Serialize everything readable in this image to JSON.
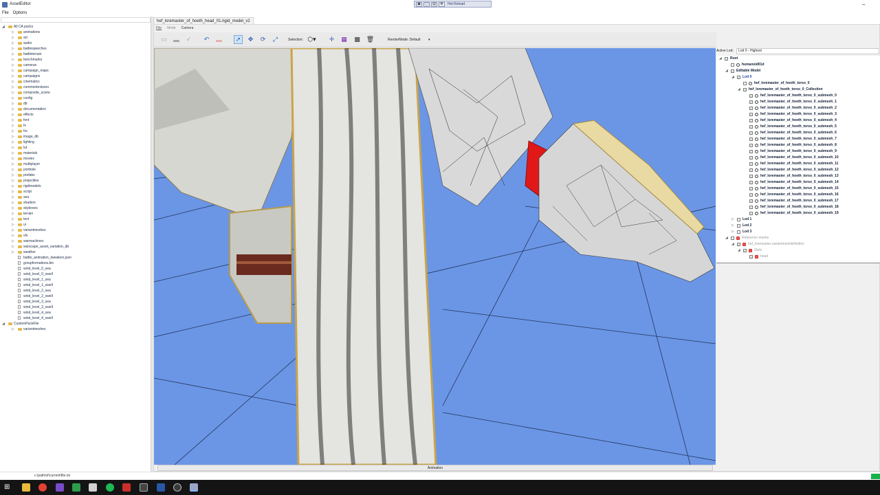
{
  "window": {
    "title": "AssetEditor"
  },
  "hot_reload": {
    "label": "Hot Reload"
  },
  "menubar": {
    "file": "File",
    "options": "Options"
  },
  "pack_tree": [
    {
      "label": "All CA packs",
      "level": 0,
      "kind": "root",
      "expanded": true
    },
    {
      "label": "animations",
      "level": 1,
      "kind": "folder"
    },
    {
      "label": "art",
      "level": 1,
      "kind": "folder"
    },
    {
      "label": "audio",
      "level": 1,
      "kind": "folder"
    },
    {
      "label": "battlespeeches",
      "level": 1,
      "kind": "folder"
    },
    {
      "label": "battleterrain",
      "level": 1,
      "kind": "folder"
    },
    {
      "label": "benchmarks",
      "level": 1,
      "kind": "folder"
    },
    {
      "label": "cameras",
      "level": 1,
      "kind": "folder"
    },
    {
      "label": "campaign_maps",
      "level": 1,
      "kind": "folder"
    },
    {
      "label": "campaigns",
      "level": 1,
      "kind": "folder"
    },
    {
      "label": "cinematics",
      "level": 1,
      "kind": "folder"
    },
    {
      "label": "commontextures",
      "level": 1,
      "kind": "folder"
    },
    {
      "label": "composite_scene",
      "level": 1,
      "kind": "folder"
    },
    {
      "label": "config",
      "level": 1,
      "kind": "folder"
    },
    {
      "label": "db",
      "level": 1,
      "kind": "folder"
    },
    {
      "label": "documentation",
      "level": 1,
      "kind": "folder"
    },
    {
      "label": "effects",
      "level": 1,
      "kind": "folder"
    },
    {
      "label": "font",
      "level": 1,
      "kind": "folder"
    },
    {
      "label": "fx",
      "level": 1,
      "kind": "folder"
    },
    {
      "label": "fxc",
      "level": 1,
      "kind": "folder"
    },
    {
      "label": "image_db",
      "level": 1,
      "kind": "folder"
    },
    {
      "label": "lighting",
      "level": 1,
      "kind": "folder"
    },
    {
      "label": "lut",
      "level": 1,
      "kind": "folder"
    },
    {
      "label": "materials",
      "level": 1,
      "kind": "folder"
    },
    {
      "label": "movies",
      "level": 1,
      "kind": "folder"
    },
    {
      "label": "multiplayer",
      "level": 1,
      "kind": "folder"
    },
    {
      "label": "porthole",
      "level": 1,
      "kind": "folder"
    },
    {
      "label": "prefabs",
      "level": 1,
      "kind": "folder"
    },
    {
      "label": "projectiles",
      "level": 1,
      "kind": "folder"
    },
    {
      "label": "rigidmodels",
      "level": 1,
      "kind": "folder"
    },
    {
      "label": "script",
      "level": 1,
      "kind": "folder"
    },
    {
      "label": "sea",
      "level": 1,
      "kind": "folder"
    },
    {
      "label": "shaders",
      "level": 1,
      "kind": "folder"
    },
    {
      "label": "skyboxes",
      "level": 1,
      "kind": "folder"
    },
    {
      "label": "terrain",
      "level": 1,
      "kind": "folder"
    },
    {
      "label": "text",
      "level": 1,
      "kind": "folder"
    },
    {
      "label": "ui",
      "level": 1,
      "kind": "folder"
    },
    {
      "label": "variantmeshes",
      "level": 1,
      "kind": "folder"
    },
    {
      "label": "vfx",
      "level": 1,
      "kind": "folder"
    },
    {
      "label": "warmachines",
      "level": 1,
      "kind": "folder"
    },
    {
      "label": "warscape_asset_variation_db",
      "level": 1,
      "kind": "folder"
    },
    {
      "label": "weather",
      "level": 1,
      "kind": "folder"
    },
    {
      "label": "battle_animation_tweakers.json",
      "level": 1,
      "kind": "file"
    },
    {
      "label": "groupformations.bin",
      "level": 1,
      "kind": "file"
    },
    {
      "label": "wind_level_0_sea",
      "level": 1,
      "kind": "file"
    },
    {
      "label": "wind_level_0_swell",
      "level": 1,
      "kind": "file"
    },
    {
      "label": "wind_level_1_sea",
      "level": 1,
      "kind": "file"
    },
    {
      "label": "wind_level_1_swell",
      "level": 1,
      "kind": "file"
    },
    {
      "label": "wind_level_2_sea",
      "level": 1,
      "kind": "file"
    },
    {
      "label": "wind_level_2_swell",
      "level": 1,
      "kind": "file"
    },
    {
      "label": "wind_level_3_sea",
      "level": 1,
      "kind": "file"
    },
    {
      "label": "wind_level_3_swell",
      "level": 1,
      "kind": "file"
    },
    {
      "label": "wind_level_4_sea",
      "level": 1,
      "kind": "file"
    },
    {
      "label": "wind_level_4_swell",
      "level": 1,
      "kind": "file"
    },
    {
      "label": "CustomPackFile",
      "level": 0,
      "kind": "root",
      "expanded": true
    },
    {
      "label": "variantmeshes",
      "level": 1,
      "kind": "folder"
    }
  ],
  "editor": {
    "tab_title": "hef_loremaster_of_hoeth_head_01.rigid_model_v2",
    "menu": {
      "file": "File",
      "mode": "Mode",
      "camera": "Camera"
    },
    "toolbar": {
      "selection_label": "Selection:",
      "render_mode_label": "RenderMode: Default"
    },
    "animation_label": "Animation"
  },
  "right_panel": {
    "active_lod_label": "Active Lod:",
    "active_lod_value": "Lod 0 - Highest",
    "scene_tree": [
      {
        "label": "Root",
        "level": 0,
        "checked": true,
        "exp": "open",
        "icon": "none"
      },
      {
        "label": "humanoid01d",
        "level": 1,
        "checked": false,
        "exp": "",
        "icon": "skeleton"
      },
      {
        "label": "Editable Model",
        "level": 1,
        "checked": true,
        "exp": "open",
        "icon": "none"
      },
      {
        "label": "Lod 0",
        "level": 2,
        "checked": true,
        "exp": "open",
        "icon": "none",
        "color": "#1b3fa8"
      },
      {
        "label": "hef_loremaster_of_hoeth_torso_0",
        "level": 3,
        "checked": false,
        "exp": "",
        "icon": "mesh"
      },
      {
        "label": "hef_loremaster_of_hoeth_torso_0_Collection",
        "level": 3,
        "checked": true,
        "exp": "open",
        "icon": "none"
      },
      {
        "label": "hef_loremaster_of_hoeth_torso_0_submesh_0",
        "level": 4,
        "checked": true,
        "exp": "",
        "icon": "mesh"
      },
      {
        "label": "hef_loremaster_of_hoeth_torso_0_submesh_1",
        "level": 4,
        "checked": true,
        "exp": "",
        "icon": "mesh"
      },
      {
        "label": "hef_loremaster_of_hoeth_torso_0_submesh_2",
        "level": 4,
        "checked": true,
        "exp": "",
        "icon": "mesh"
      },
      {
        "label": "hef_loremaster_of_hoeth_torso_0_submesh_3",
        "level": 4,
        "checked": true,
        "exp": "",
        "icon": "mesh"
      },
      {
        "label": "hef_loremaster_of_hoeth_torso_0_submesh_4",
        "level": 4,
        "checked": true,
        "exp": "",
        "icon": "mesh"
      },
      {
        "label": "hef_loremaster_of_hoeth_torso_0_submesh_5",
        "level": 4,
        "checked": true,
        "exp": "",
        "icon": "mesh"
      },
      {
        "label": "hef_loremaster_of_hoeth_torso_0_submesh_6",
        "level": 4,
        "checked": true,
        "exp": "",
        "icon": "mesh"
      },
      {
        "label": "hef_loremaster_of_hoeth_torso_0_submesh_7",
        "level": 4,
        "checked": true,
        "exp": "",
        "icon": "mesh"
      },
      {
        "label": "hef_loremaster_of_hoeth_torso_0_submesh_8",
        "level": 4,
        "checked": true,
        "exp": "",
        "icon": "mesh"
      },
      {
        "label": "hef_loremaster_of_hoeth_torso_0_submesh_9",
        "level": 4,
        "checked": true,
        "exp": "",
        "icon": "mesh"
      },
      {
        "label": "hef_loremaster_of_hoeth_torso_0_submesh_10",
        "level": 4,
        "checked": true,
        "exp": "",
        "icon": "mesh"
      },
      {
        "label": "hef_loremaster_of_hoeth_torso_0_submesh_11",
        "level": 4,
        "checked": true,
        "exp": "",
        "icon": "mesh"
      },
      {
        "label": "hef_loremaster_of_hoeth_torso_0_submesh_12",
        "level": 4,
        "checked": true,
        "exp": "",
        "icon": "mesh"
      },
      {
        "label": "hef_loremaster_of_hoeth_torso_0_submesh_13",
        "level": 4,
        "checked": true,
        "exp": "",
        "icon": "mesh"
      },
      {
        "label": "hef_loremaster_of_hoeth_torso_0_submesh_14",
        "level": 4,
        "checked": true,
        "exp": "",
        "icon": "mesh"
      },
      {
        "label": "hef_loremaster_of_hoeth_torso_0_submesh_15",
        "level": 4,
        "checked": true,
        "exp": "",
        "icon": "mesh"
      },
      {
        "label": "hef_loremaster_of_hoeth_torso_0_submesh_16",
        "level": 4,
        "checked": true,
        "exp": "",
        "icon": "mesh"
      },
      {
        "label": "hef_loremaster_of_hoeth_torso_0_submesh_17",
        "level": 4,
        "checked": true,
        "exp": "",
        "icon": "mesh"
      },
      {
        "label": "hef_loremaster_of_hoeth_torso_0_submesh_18",
        "level": 4,
        "checked": true,
        "exp": "",
        "icon": "mesh"
      },
      {
        "label": "hef_loremaster_of_hoeth_torso_0_submesh_19",
        "level": 4,
        "checked": true,
        "exp": "",
        "icon": "mesh"
      },
      {
        "label": "Lod 1",
        "level": 2,
        "checked": false,
        "exp": "closed",
        "icon": "none"
      },
      {
        "label": "Lod 2",
        "level": 2,
        "checked": false,
        "exp": "closed",
        "icon": "none"
      },
      {
        "label": "Lod 3",
        "level": 2,
        "checked": false,
        "exp": "closed",
        "icon": "none"
      },
      {
        "label": "Reference meshs",
        "level": 1,
        "checked": false,
        "exp": "open",
        "icon": "ref",
        "faded": true
      },
      {
        "label": "hef_loremaster.variantmeshdefinition",
        "level": 2,
        "checked": true,
        "exp": "open",
        "icon": "ref",
        "faded": true
      },
      {
        "label": "Slots",
        "level": 3,
        "checked": true,
        "exp": "open",
        "icon": "ref",
        "faded": true
      },
      {
        "label": "head",
        "level": 4,
        "checked": true,
        "exp": "",
        "icon": "ref",
        "faded": true
      }
    ]
  },
  "statusbar": {
    "path": "c:\\path\\of\\current\\file.txt"
  },
  "colors": {
    "viewport_bg": "#6b96e6",
    "selected_mesh": "#e01818",
    "status_ok": "#17b34a"
  }
}
